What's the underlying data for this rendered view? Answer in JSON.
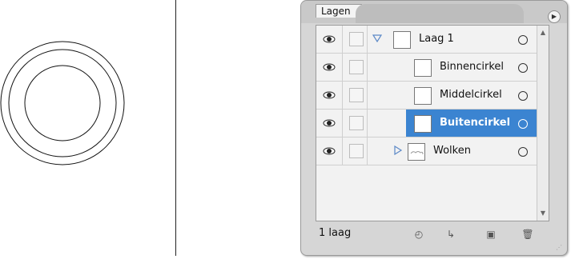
{
  "panel": {
    "tab_label": "Lagen",
    "footer_count": "1 laag"
  },
  "layers": [
    {
      "name": "Laag 1",
      "level": 0,
      "expanded": true,
      "selected": false
    },
    {
      "name": "Binnencirkel",
      "level": 1,
      "selected": false
    },
    {
      "name": "Middelcirkel",
      "level": 1,
      "selected": false
    },
    {
      "name": "Buitencirkel",
      "level": 1,
      "selected": true
    },
    {
      "name": "Wolken",
      "level": 0,
      "expanded": false,
      "selected": false
    }
  ],
  "colors": {
    "selection": "#3b84d1",
    "panel_bg": "#d6d6d6"
  },
  "icons": {
    "visibility": "eye-icon",
    "lock": "lock-toggle",
    "footer": [
      "make-clipping-mask-icon",
      "create-sublayer-icon",
      "new-layer-icon",
      "delete-layer-icon"
    ]
  }
}
